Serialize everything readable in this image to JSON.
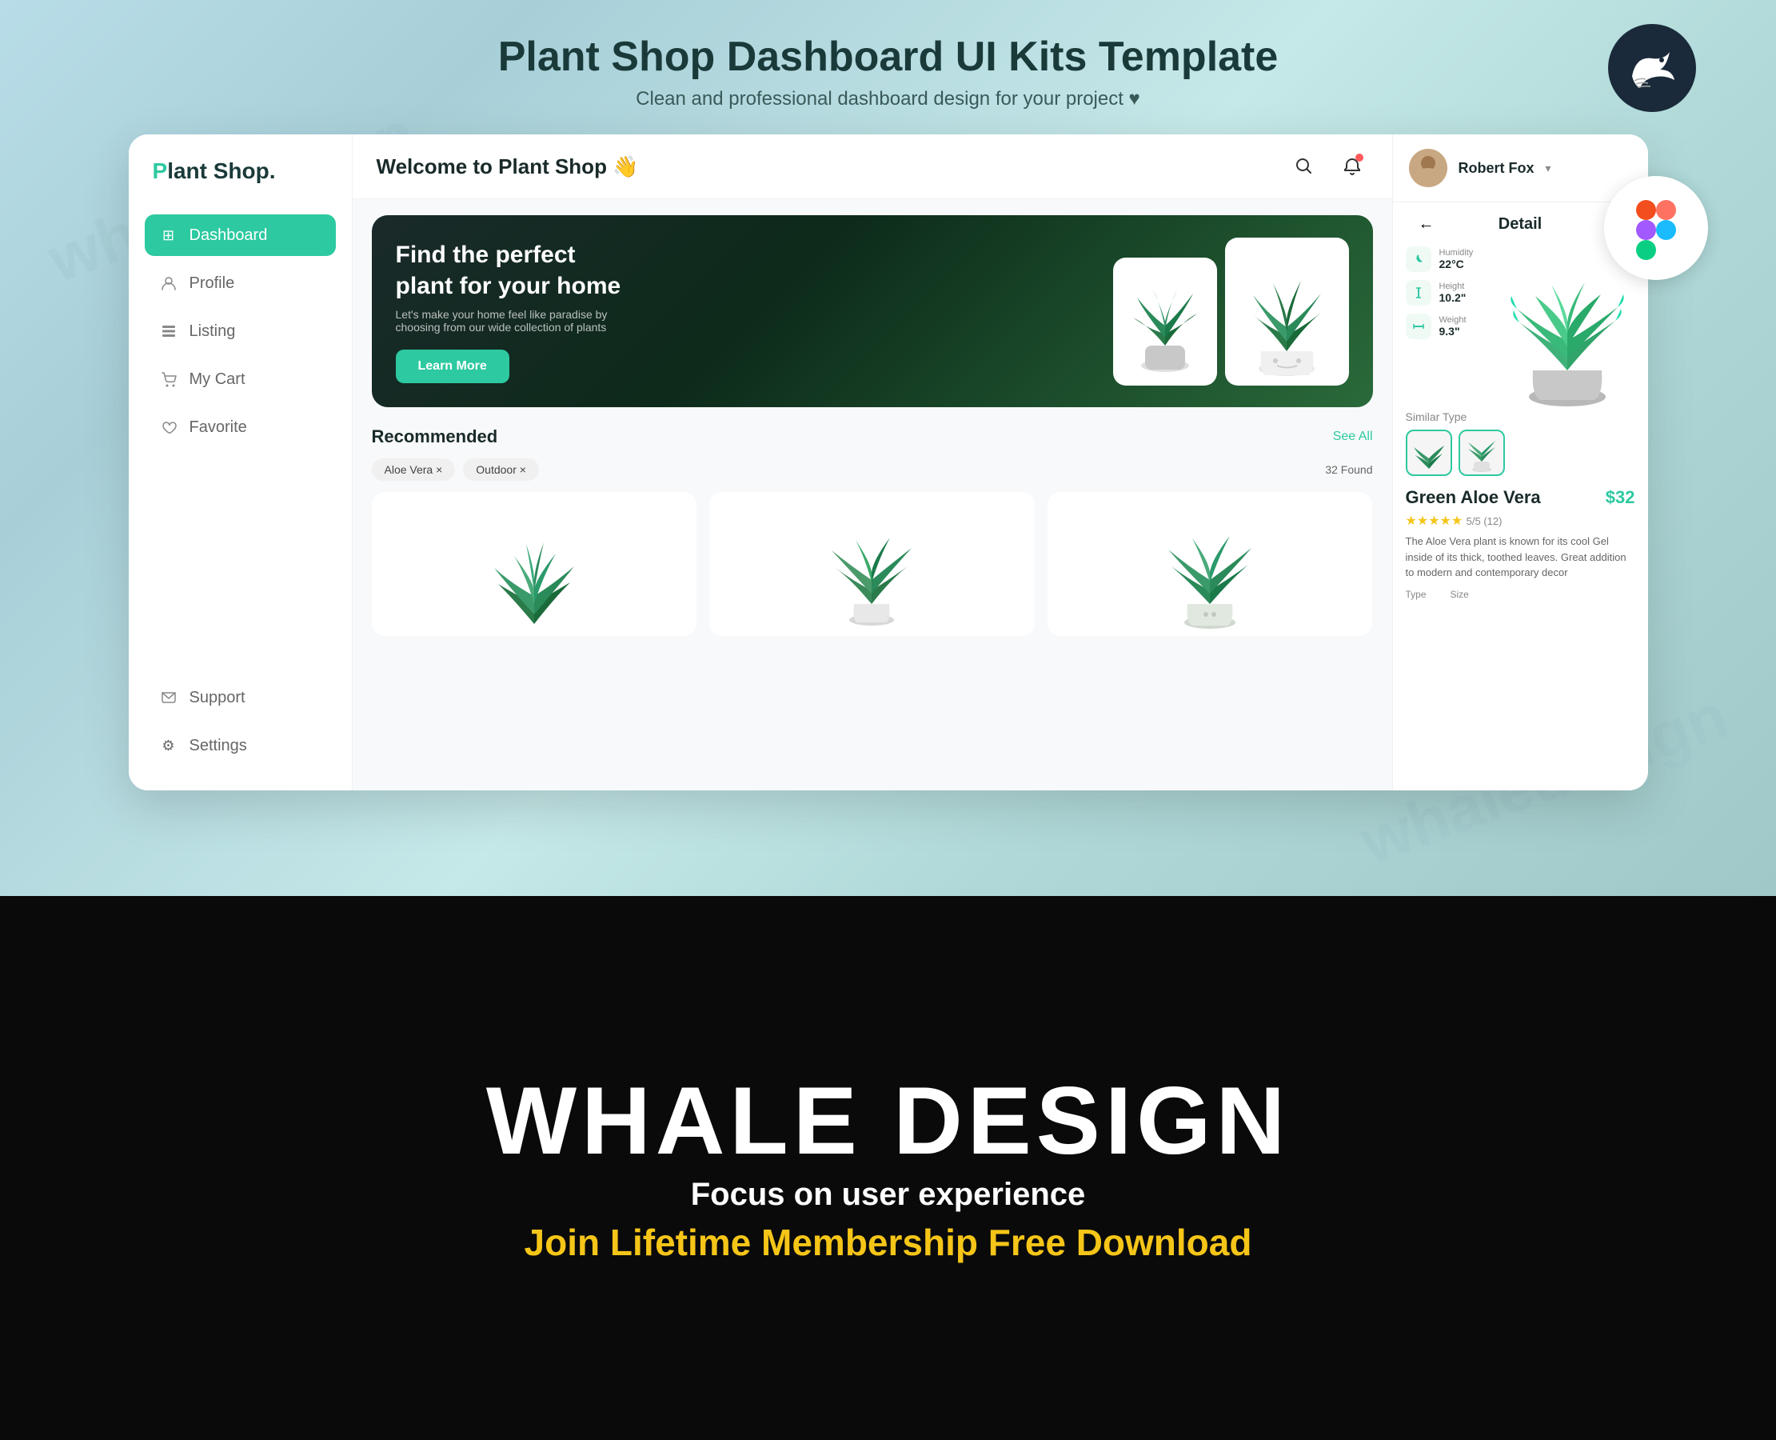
{
  "header": {
    "title": "Plant Shop Dashboard UI Kits Template",
    "subtitle": "Clean and professional dashboard design for your project ♥"
  },
  "watermark": "whaledesign",
  "logo": {
    "prefix": "P",
    "text": "lant Shop."
  },
  "nav": {
    "items": [
      {
        "id": "dashboard",
        "label": "Dashboard",
        "icon": "⊞",
        "active": true
      },
      {
        "id": "profile",
        "label": "Profile",
        "icon": "👤",
        "active": false
      },
      {
        "id": "listing",
        "label": "Listing",
        "icon": "📋",
        "active": false
      },
      {
        "id": "mycart",
        "label": "My Cart",
        "icon": "🛍",
        "active": false
      },
      {
        "id": "favorite",
        "label": "Favorite",
        "icon": "★",
        "active": false
      },
      {
        "id": "support",
        "label": "Support",
        "icon": "💬",
        "active": false
      },
      {
        "id": "settings",
        "label": "Settings",
        "icon": "⚙",
        "active": false
      }
    ]
  },
  "main": {
    "welcome": "Welcome to",
    "welcome_bold": "Plant Shop",
    "welcome_emoji": "👋"
  },
  "hero": {
    "title": "Find the perfect plant for your home",
    "subtitle": "Let's make your home feel like paradise by choosing from our wide collection of plants",
    "cta": "Learn More"
  },
  "recommended": {
    "title": "Recommended",
    "see_all": "See All",
    "filters": [
      "Aloe Vera ×",
      "Outdoor ×"
    ],
    "found": "32 Found"
  },
  "user": {
    "name": "Robert Fox",
    "chevron": "▾"
  },
  "detail": {
    "nav_label": "Detail",
    "humidity_label": "Humidity",
    "humidity_value": "22°C",
    "height_label": "Height",
    "height_value": "10.2\"",
    "weight_label": "Weight",
    "weight_value": "9.3\"",
    "similar_label": "Similar Type",
    "plant_name": "Green Aloe Vera",
    "plant_price": "$32",
    "stars": "★★★★★",
    "rating": "5/5 (12)",
    "description": "The Aloe Vera plant is known for its cool Gel inside of its thick, toothed leaves. Great addition to modern and contemporary decor",
    "type_label": "Type",
    "size_label": "Size"
  },
  "bottom": {
    "brand": "WHALE DESIGN",
    "tagline": "Focus on user experience",
    "cta": "Join Lifetime Membership Free Download"
  }
}
